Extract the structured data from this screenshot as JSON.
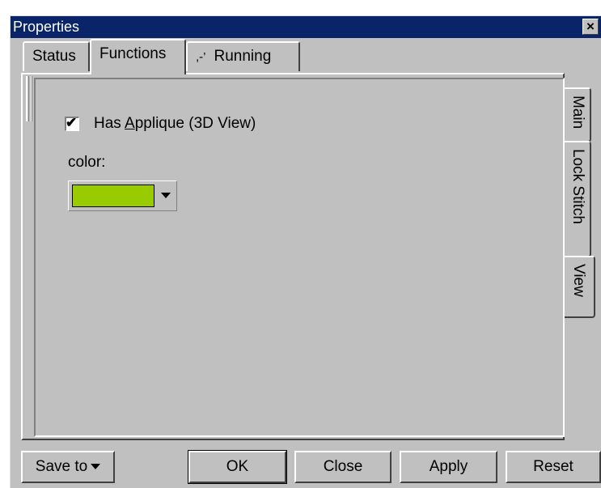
{
  "window": {
    "title": "Properties",
    "close_glyph": "×"
  },
  "tabs": [
    {
      "label": "Status",
      "active": false
    },
    {
      "label": "Functions",
      "active": true
    },
    {
      "label": "Running",
      "icon_glyph": ",-’",
      "active": false
    }
  ],
  "side_tabs": [
    {
      "label": "Main",
      "active": false
    },
    {
      "label": "Lock Stitch",
      "active": false
    },
    {
      "label": "View",
      "active": true
    }
  ],
  "view_page": {
    "checkbox": {
      "label_prefix": "Has ",
      "label_mnemonic": "A",
      "label_rest": "pplique (3D View)",
      "checked": true,
      "check_glyph": "✔"
    },
    "color_label": "color:",
    "color_value": "#99cc00"
  },
  "buttons": {
    "save_to": "Save to",
    "ok": "OK",
    "close": "Close",
    "apply": "Apply",
    "reset": "Reset"
  }
}
